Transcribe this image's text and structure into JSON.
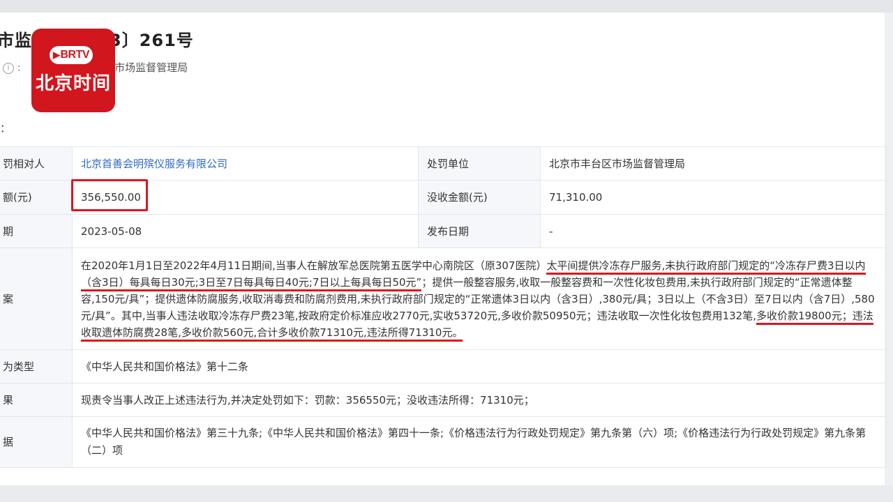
{
  "header": {
    "title": "市监处〔2023〕261号",
    "title_display": "市监处",
    "title_tail": "3〕261号",
    "meta": "理局,市场监督管理局"
  },
  "logo": {
    "badge": "BRTV",
    "name": "北京时间"
  },
  "section_mark": "：",
  "rows": {
    "party_label": "罚相对人",
    "party_value": "北京首善会明殡仪服务有限公司",
    "unit_label": "处罚单位",
    "unit_value": "北京市丰台区市场监督管理局",
    "fine_label": "额(元)",
    "fine_value": "356,550.00",
    "confiscate_label": "没收金额(元)",
    "confiscate_value": "71,310.00",
    "date_label": "期",
    "date_value": "2023-05-08",
    "publish_label": "发布日期",
    "publish_value": "-",
    "facts_label": "案",
    "facts": {
      "p1": "在2020年1月1日至2022年4月11日期间,当事人在解放军总医院第五医学中心南院区（原307医院）",
      "u1": "太平间提供冷冻存尸服务,未执行政府部门规定的“冷冻存尸费3日以内（含3日）每具每日30元;3日至7日每具每日40元;7日以上每具每日50元”",
      "p2": "；提供一般整容服务,收取一般整容费和一次性化妆包费用,未执行政府部门规定的“正常遗体整容,150元/具”；提供遗体防腐服务,收取消毒费和防腐剂费用,未执行政府部门规定的“正常遗体3日以内（含3日）,380元/具；3日以上（不含3日）至7日以内（含7日）,580元/具”。其中,当事人违法收取冷冻存尸费23笔,按政府定价标准应收2770元,实收53720元,多收价款50950元；违法收取一次性化妆包费用132笔,",
      "u2": "多收价款19800元；违法收取遗体防腐费28笔,多收价款560元,合计多收价款71310元,违法所得71310元。"
    },
    "type_label": "为类型",
    "type_value": "《中华人民共和国价格法》第十二条",
    "result_label": "果",
    "result_value": "现责令当事人改正上述违法行为,并决定处罚如下：罚款：356550元；没收违法所得：71310元；",
    "basis_label": "据",
    "basis_value": "《中华人民共和国价格法》第三十九条;《中华人民共和国价格法》第四十一条;《价格违法行为行政处罚规定》第九条第（六）项;《价格违法行为行政处罚规定》第九条第（二）项"
  },
  "colors": {
    "accent_red": "#e0141e",
    "link_blue": "#2f6ac5",
    "logo_red": "#d2161e"
  }
}
